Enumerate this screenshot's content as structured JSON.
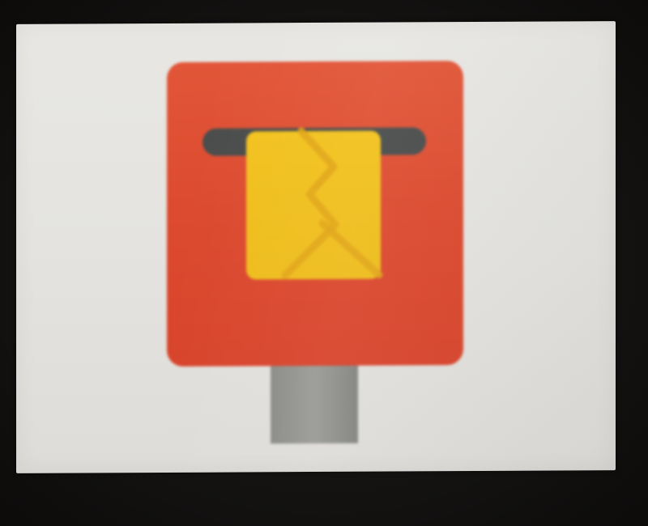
{
  "image": {
    "subject": "postbox-emoji",
    "colors": {
      "background_screen": "#e6e5e1",
      "frame": "#141312",
      "postbox_body": "#de4a30",
      "postbox_body_top": "#e3573a",
      "slot": "#4a4d4c",
      "letter": "#f0c020",
      "letter_fold": "#e0a818",
      "post": "#8c8d89"
    }
  }
}
